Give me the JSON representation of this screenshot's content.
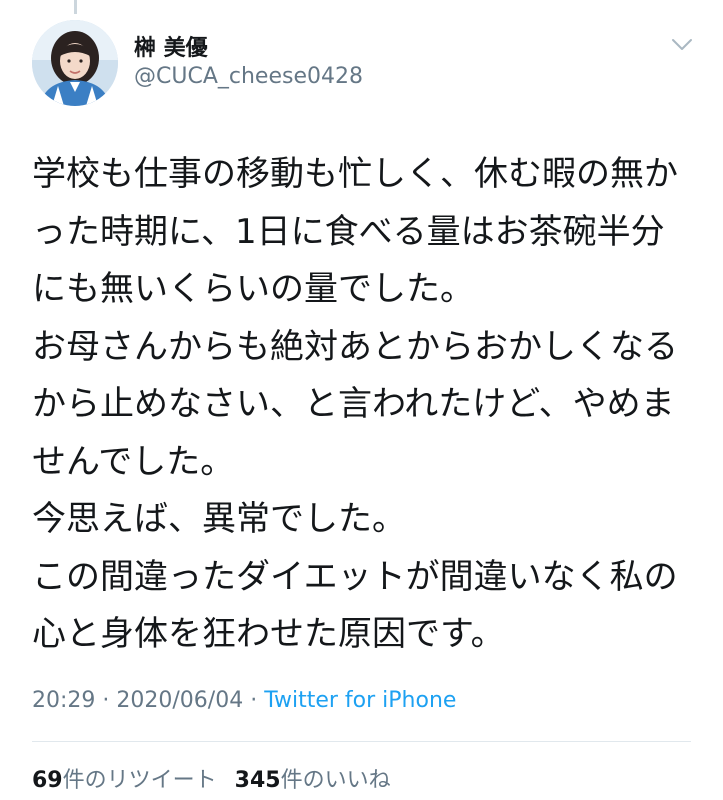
{
  "author": {
    "display_name": "榊 美優",
    "handle": "@CUCA_cheese0428",
    "avatar_icon": "profile-photo"
  },
  "tweet": {
    "text": "学校も仕事の移動も忙しく、休む暇の無かった時期に、1日に食べる量はお茶碗半分にも無いくらいの量でした。\nお母さんからも絶対あとからおかしくなるから止めなさい、と言われたけど、やめませんでした。\n今思えば、異常でした。\nこの間違ったダイエットが間違いなく私の心と身体を狂わせた原因です。",
    "time": "20:29",
    "separator1": " · ",
    "date": "2020/06/04",
    "separator2": " · ",
    "source": "Twitter for iPhone"
  },
  "stats": {
    "retweet_count": "69",
    "retweet_label": "件のリツイート",
    "like_count": "345",
    "like_label": "件のいいね"
  },
  "colors": {
    "text": "#14171a",
    "secondary": "#657786",
    "link": "#1da1f2",
    "divider": "#e1e8ed"
  }
}
